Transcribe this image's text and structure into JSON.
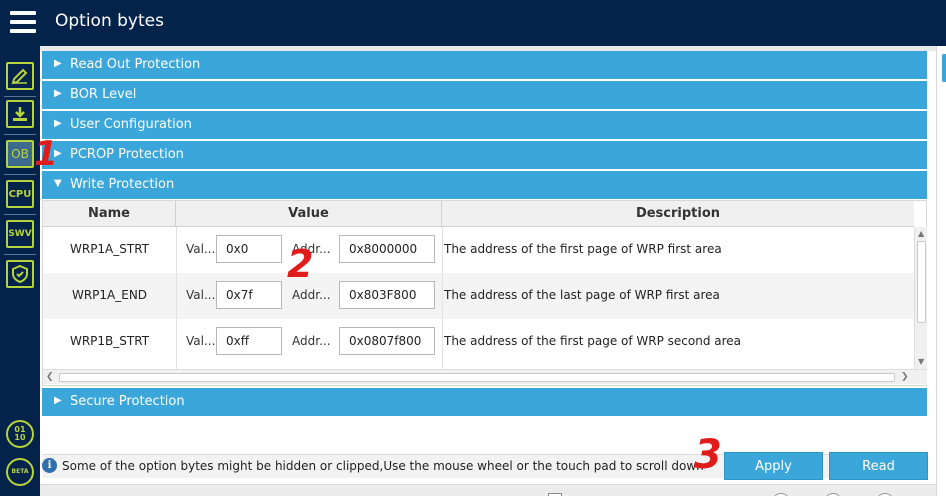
{
  "window": {
    "title": "Option bytes"
  },
  "sidebar": {
    "items": [
      {
        "icon": "pencil-icon"
      },
      {
        "icon": "download-icon"
      },
      {
        "label": "OB",
        "icon": "ob-icon",
        "active": true
      },
      {
        "label": "CPU",
        "icon": "cpu-icon"
      },
      {
        "label": "SWV",
        "icon": "swv-icon"
      },
      {
        "icon": "shield-icon"
      },
      {
        "label": "01\n10",
        "icon": "binary-icon"
      },
      {
        "label": "BETA",
        "icon": "beta-icon"
      }
    ]
  },
  "sections": {
    "read_out": "Read Out Protection",
    "bor": "BOR Level",
    "user_config": "User Configuration",
    "pcrop": "PCROP Protection",
    "write_prot": "Write Protection",
    "secure": "Secure Protection"
  },
  "table": {
    "headers": {
      "name": "Name",
      "value": "Value",
      "description": "Description"
    },
    "rows": [
      {
        "name": "WRP1A_STRT",
        "val_label": "Val...",
        "value": "0x0",
        "addr_label": "Addr...",
        "address": "0x8000000",
        "description": "The address of the first page of WRP first area"
      },
      {
        "name": "WRP1A_END",
        "val_label": "Val...",
        "value": "0x7f",
        "addr_label": "Addr...",
        "address": "0x803F800",
        "description": "The address of the last page of WRP first area"
      },
      {
        "name": "WRP1B_STRT",
        "val_label": "Val...",
        "value": "0xff",
        "addr_label": "Addr...",
        "address": "0x0807f800",
        "description": "The address of the first page of  WRP second area"
      }
    ]
  },
  "footer": {
    "info": "Some of the option bytes might be hidden or clipped,Use the mouse wheel or the touch pad to scroll down",
    "apply_label": "Apply",
    "read_label": "Read"
  },
  "annotations": {
    "one": "1",
    "two": "2",
    "three": "3"
  },
  "colors": {
    "titlebar": "#03234b",
    "accent": "#3aa6d9",
    "sidebar_icon": "#b7d33b",
    "annotation": "#e01b1b"
  }
}
